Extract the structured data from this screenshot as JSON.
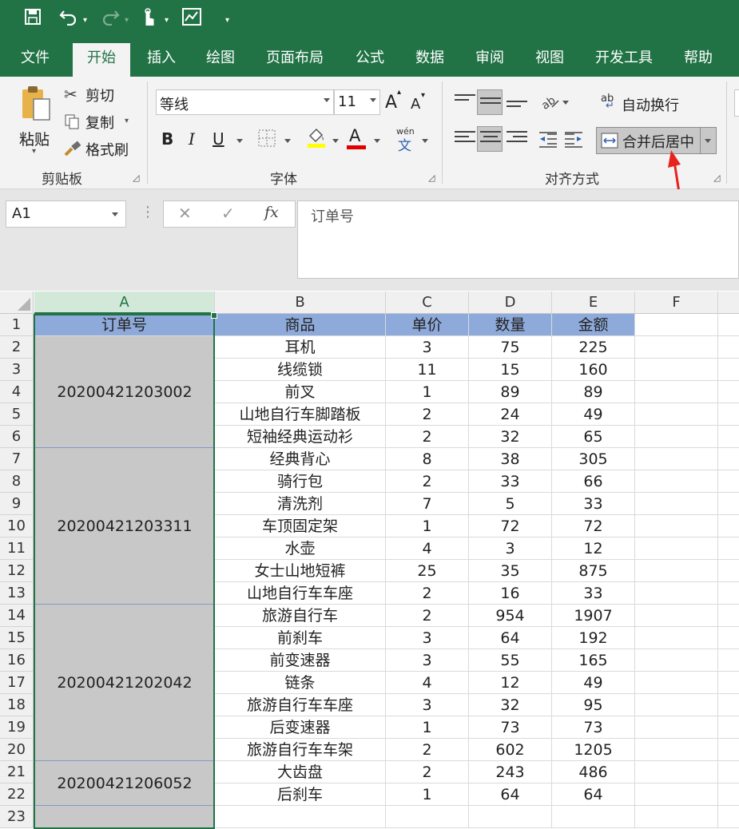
{
  "quick_access": {
    "save_icon": "save-icon",
    "undo_icon": "undo-icon",
    "redo_icon": "redo-icon",
    "touch_icon": "touch-mode-icon",
    "chart_icon": "chart-icon",
    "customize_icon": "customize-icon"
  },
  "tabs": [
    {
      "label": "文件"
    },
    {
      "label": "开始",
      "active": true
    },
    {
      "label": "插入"
    },
    {
      "label": "绘图"
    },
    {
      "label": "页面布局"
    },
    {
      "label": "公式"
    },
    {
      "label": "数据"
    },
    {
      "label": "审阅"
    },
    {
      "label": "视图"
    },
    {
      "label": "开发工具"
    },
    {
      "label": "帮助"
    }
  ],
  "ribbon": {
    "clipboard": {
      "label": "剪贴板",
      "paste": "粘贴",
      "cut": "剪切",
      "copy": "复制",
      "format_painter": "格式刷"
    },
    "font": {
      "label": "字体",
      "font_name": "等线",
      "font_size": "11",
      "bold": "B",
      "italic": "I",
      "underline": "U",
      "font_color_letter": "A",
      "grow": "A",
      "shrink": "A",
      "phonetic_top": "wén",
      "phonetic_bottom": "文"
    },
    "alignment": {
      "label": "对齐方式",
      "wrap_text": "自动换行",
      "wrap_icon_text": "ab",
      "merge_center": "合并后居中"
    }
  },
  "formula_bar": {
    "name_box": "A1",
    "cancel": "✕",
    "enter": "✓",
    "fx": "fx",
    "content": "订单号"
  },
  "sheet": {
    "columns": [
      "A",
      "B",
      "C",
      "D",
      "E",
      "F"
    ],
    "rows": [
      "1",
      "2",
      "3",
      "4",
      "5",
      "6",
      "7",
      "8",
      "9",
      "10",
      "11",
      "12",
      "13",
      "14",
      "15",
      "16",
      "17",
      "18",
      "19",
      "20",
      "21",
      "22",
      "23"
    ],
    "headers": [
      "订单号",
      "商品",
      "单价",
      "数量",
      "金额"
    ],
    "orders": [
      {
        "id": "20200421203002",
        "start": 2,
        "end": 6
      },
      {
        "id": "20200421203311",
        "start": 7,
        "end": 13
      },
      {
        "id": "20200421202042",
        "start": 14,
        "end": 20
      },
      {
        "id": "20200421206052",
        "start": 21,
        "end": 22
      }
    ],
    "data": [
      [
        "耳机",
        "3",
        "75",
        "225"
      ],
      [
        "线缆锁",
        "11",
        "15",
        "160"
      ],
      [
        "前叉",
        "1",
        "89",
        "89"
      ],
      [
        "山地自行车脚踏板",
        "2",
        "24",
        "49"
      ],
      [
        "短袖经典运动衫",
        "2",
        "32",
        "65"
      ],
      [
        "经典背心",
        "8",
        "38",
        "305"
      ],
      [
        "骑行包",
        "2",
        "33",
        "66"
      ],
      [
        "清洗剂",
        "7",
        "5",
        "33"
      ],
      [
        "车顶固定架",
        "1",
        "72",
        "72"
      ],
      [
        "水壶",
        "4",
        "3",
        "12"
      ],
      [
        "女士山地短裤",
        "25",
        "35",
        "875"
      ],
      [
        "山地自行车车座",
        "2",
        "16",
        "33"
      ],
      [
        "旅游自行车",
        "2",
        "954",
        "1907"
      ],
      [
        "前刹车",
        "3",
        "64",
        "192"
      ],
      [
        "前变速器",
        "3",
        "55",
        "165"
      ],
      [
        "链条",
        "4",
        "12",
        "49"
      ],
      [
        "旅游自行车车座",
        "3",
        "32",
        "95"
      ],
      [
        "后变速器",
        "1",
        "73",
        "73"
      ],
      [
        "旅游自行车车架",
        "2",
        "602",
        "1205"
      ],
      [
        "大齿盘",
        "2",
        "243",
        "486"
      ],
      [
        "后刹车",
        "1",
        "64",
        "64"
      ]
    ]
  },
  "colors": {
    "excel_green": "#217346",
    "header_fill": "#8eaadb",
    "merged_fill": "#c8c8c8",
    "arrow_red": "#e8221c"
  }
}
